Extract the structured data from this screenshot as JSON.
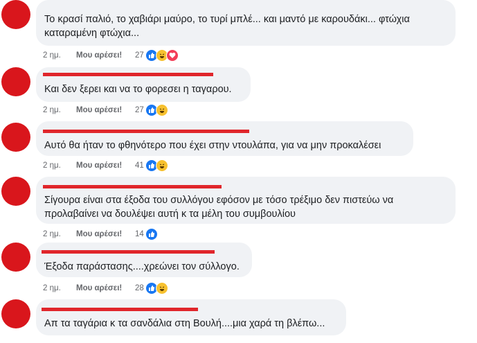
{
  "comments": [
    {
      "name_fragment": "",
      "text_lines": [
        "Το κρασί παλιό, το χαβιάρι μαύρο, το τυρί μπλέ... και μαντό με καρουδάκι... φτώχια",
        "καταραμένη φτώχια..."
      ],
      "time": "2 ημ.",
      "like_label": "Μου αρέσει!",
      "reaction_count": "27",
      "reactions": [
        "like-icon",
        "haha-icon",
        "love-icon"
      ]
    },
    {
      "name_fragment": "",
      "text_lines": [
        "Και δεν ξερει και να το φορεσει η ταγαρου."
      ],
      "time": "2 ημ.",
      "like_label": "Μου αρέσει!",
      "reaction_count": "27",
      "reactions": [
        "like-icon",
        "haha-icon"
      ]
    },
    {
      "name_fragment": "",
      "text_lines": [
        "Αυτό θα ήταν το φθηνότερο που έχει στην ντουλάπα, για να μην προκαλέσει"
      ],
      "time": "2 ημ.",
      "like_label": "Μου αρέσει!",
      "reaction_count": "41",
      "reactions": [
        "like-icon",
        "haha-icon"
      ]
    },
    {
      "name_fragment": "",
      "text_lines": [
        "Σίγουρα είναι στα έξοδα του συλλόγου εφόσον με τόσο τρέξιμο δεν πιστεύω να",
        "προλαβαίνει να δουλέψει αυτή κ τα μέλη του συμβουλίου"
      ],
      "time": "2 ημ.",
      "like_label": "Μου αρέσει!",
      "reaction_count": "14",
      "reactions": [
        "like-icon"
      ]
    },
    {
      "name_fragment": "",
      "text_lines": [
        "Έξοδα παράστασης....χρεώνει τον σύλλογο."
      ],
      "time": "2 ημ.",
      "like_label": "Μου αρέσει!",
      "reaction_count": "28",
      "reactions": [
        "like-icon",
        "haha-icon"
      ]
    },
    {
      "name_fragment": "",
      "text_lines": [
        "Απ τα ταγάρια κ τα σανδάλια στη Βουλή....μια χαρά τη βλέπω..."
      ],
      "time": "",
      "like_label": "",
      "reaction_count": "",
      "reactions": []
    }
  ],
  "colors": {
    "redaction": "#e0262b",
    "avatar": "#d9161c",
    "bubble": "#f0f2f5",
    "like_blue": "#1877f2",
    "haha_yellow": "#f7c12f",
    "love_red": "#f33e58"
  }
}
